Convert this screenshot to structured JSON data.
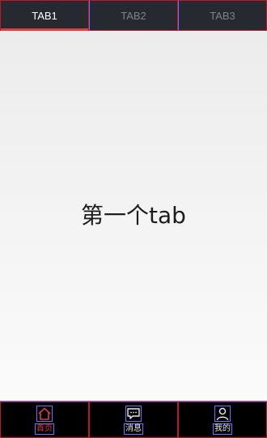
{
  "tabs": [
    {
      "label": "TAB1",
      "active": true
    },
    {
      "label": "TAB2",
      "active": false
    },
    {
      "label": "TAB3",
      "active": false
    }
  ],
  "content": {
    "text": "第一个tab"
  },
  "bottom_nav": [
    {
      "label": "首页",
      "icon": "home-icon",
      "active": true
    },
    {
      "label": "消息",
      "icon": "message-icon",
      "active": false
    },
    {
      "label": "我的",
      "icon": "profile-icon",
      "active": false
    }
  ],
  "colors": {
    "accent": "#e23a3e",
    "tabbar_bg": "#262a30",
    "content_bg": "#f2f2f2"
  }
}
